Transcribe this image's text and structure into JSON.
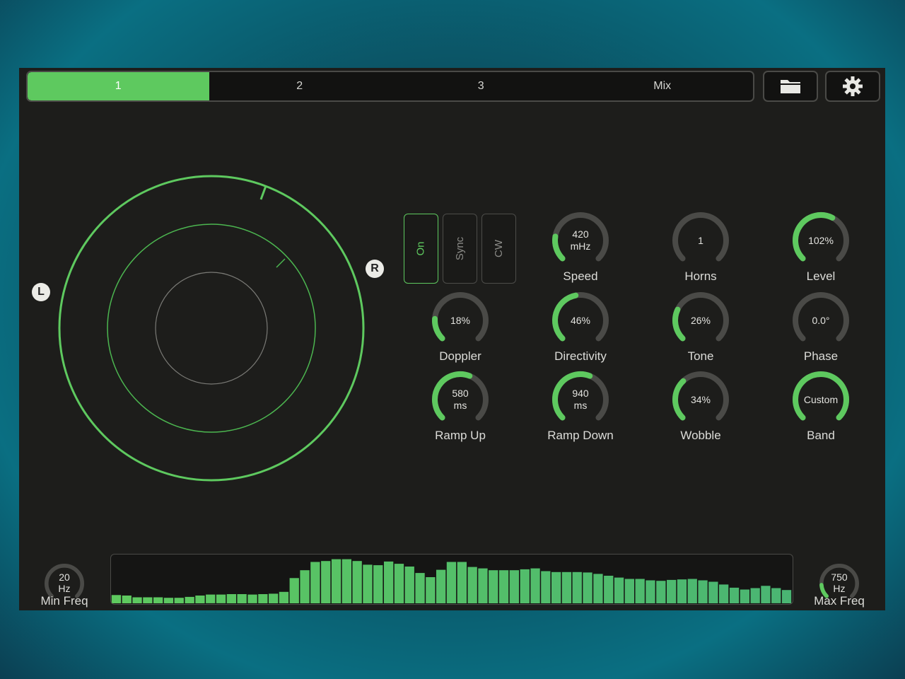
{
  "tabs": [
    {
      "label": "1",
      "active": true
    },
    {
      "label": "2",
      "active": false
    },
    {
      "label": "3",
      "active": false
    },
    {
      "label": "Mix",
      "active": false
    }
  ],
  "toolbar": {
    "folder_icon": "folder-icon",
    "settings_icon": "gear-icon"
  },
  "channels": {
    "left": "L",
    "right": "R"
  },
  "toggles": {
    "on": "On",
    "sync": "Sync",
    "cw": "CW"
  },
  "knobs": {
    "speed": {
      "value": "420\nmHz",
      "label": "Speed",
      "level": 0.2
    },
    "horns": {
      "value": "1",
      "label": "Horns",
      "level": 0.0
    },
    "level": {
      "value": "102%",
      "label": "Level",
      "level": 0.6
    },
    "doppler": {
      "value": "18%",
      "label": "Doppler",
      "level": 0.18
    },
    "directivity": {
      "value": "46%",
      "label": "Directivity",
      "level": 0.46
    },
    "tone": {
      "value": "26%",
      "label": "Tone",
      "level": 0.26
    },
    "phase": {
      "value": "0.0°",
      "label": "Phase",
      "level": 0.0
    },
    "ramp_up": {
      "value": "580\nms",
      "label": "Ramp Up",
      "level": 0.58
    },
    "ramp_down": {
      "value": "940\nms",
      "label": "Ramp Down",
      "level": 0.58
    },
    "wobble": {
      "value": "34%",
      "label": "Wobble",
      "level": 0.34
    },
    "band": {
      "value": "Custom",
      "label": "Band",
      "level": 1.0
    },
    "min_freq": {
      "value": "20\nHz",
      "label": "Min Freq",
      "level": 0.0
    },
    "max_freq": {
      "value": "750\nHz",
      "label": "Max Freq",
      "level": 0.15
    }
  },
  "spectrum": {
    "levels": [
      0.18,
      0.17,
      0.13,
      0.13,
      0.13,
      0.12,
      0.12,
      0.14,
      0.17,
      0.19,
      0.19,
      0.2,
      0.2,
      0.19,
      0.2,
      0.21,
      0.25,
      0.55,
      0.72,
      0.9,
      0.92,
      0.96,
      0.96,
      0.92,
      0.84,
      0.83,
      0.91,
      0.86,
      0.8,
      0.66,
      0.57,
      0.73,
      0.9,
      0.9,
      0.79,
      0.76,
      0.72,
      0.72,
      0.72,
      0.74,
      0.76,
      0.7,
      0.68,
      0.68,
      0.68,
      0.67,
      0.64,
      0.6,
      0.56,
      0.53,
      0.53,
      0.5,
      0.49,
      0.51,
      0.52,
      0.53,
      0.5,
      0.47,
      0.41,
      0.34,
      0.3,
      0.33,
      0.38,
      0.33,
      0.29
    ]
  }
}
